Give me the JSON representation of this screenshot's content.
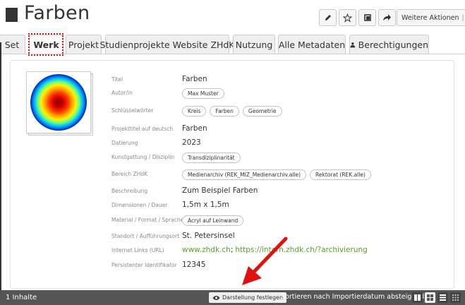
{
  "title": "Farben",
  "actions": {
    "more_label": "Weitere Aktionen",
    "more_separator": "|",
    "icons": [
      "pencil-icon",
      "star-icon",
      "share-icon",
      "forward-icon"
    ]
  },
  "tabs": [
    {
      "label": "Set"
    },
    {
      "label": "Werk"
    },
    {
      "label": "Projekt"
    },
    {
      "label": "Studienprojekte Website ZHdK"
    },
    {
      "label": "Nutzung"
    },
    {
      "label": "Alle Metadaten"
    },
    {
      "label": "Berechtigungen"
    }
  ],
  "active_tab": "Werk",
  "meta": {
    "titel": {
      "label": "Titel",
      "value": "Farben"
    },
    "autor": {
      "label": "Autor/in",
      "value": "Max Muster"
    },
    "keywords": {
      "label": "Schlüsselwörter",
      "values": [
        "Kreis",
        "Farben",
        "Geometrie"
      ]
    },
    "projekttitel": {
      "label": "Projekttitel auf deutsch",
      "value": "Farben"
    },
    "datierung": {
      "label": "Datierung",
      "value": "2023"
    },
    "kunstgattung": {
      "label": "Kunstgattung / Disziplin",
      "value": "Transdiziplinarität"
    },
    "bereich": {
      "label": "Bereich ZHdK",
      "values": [
        "Medienarchiv (REK_MIZ_Medienarchiv.alle)",
        "Rektorat (REK.alle)"
      ]
    },
    "beschreibung": {
      "label": "Beschreibung",
      "value": "Zum Beispiel Farben"
    },
    "dimensionen": {
      "label": "Dimensionen / Dauer",
      "value": "1,5m x 1,5m"
    },
    "material": {
      "label": "Material / Format / Sprache",
      "value": "Acryl auf Leinwand"
    },
    "standort": {
      "label": "Standort / Aufführungsort",
      "value": "St. Petersinsel"
    },
    "links": {
      "label": "Internet Links (URL)",
      "link1": "www.zhdk.ch",
      "sep": ";",
      "link2": "https://intern.zhdk.ch/?archivierung"
    },
    "persistent": {
      "label": "Persistenter Identifikator",
      "value": "12345"
    }
  },
  "bottom_bar": {
    "count": "1 Inhalte",
    "layout_button": "Darstellung festlegen",
    "sort": "Sortieren nach Importierdatum absteigend",
    "sort_caret": "▾",
    "view_icons": [
      "tiles-icon",
      "grid-icon",
      "list-icon",
      "miniature-icon"
    ]
  },
  "colors": {
    "link": "#5aa02c",
    "annotation": "#e01010",
    "bottom_bar": "#555555"
  }
}
